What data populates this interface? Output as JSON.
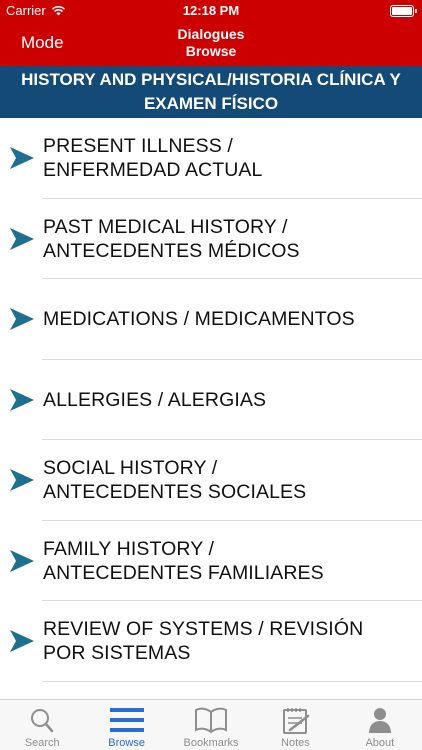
{
  "status_bar": {
    "carrier": "Carrier",
    "time": "12:18 PM"
  },
  "nav": {
    "mode_label": "Mode",
    "title_line1": "Dialogues",
    "title_line2": "Browse"
  },
  "section": {
    "title": "HISTORY AND PHYSICAL/HISTORIA CLÍNICA Y EXAMEN FÍSICO"
  },
  "list": {
    "items": [
      {
        "line1": "PRESENT ILLNESS /",
        "line2": "ENFERMEDAD ACTUAL"
      },
      {
        "line1": "PAST MEDICAL HISTORY /",
        "line2": "ANTECEDENTES MÉDICOS"
      },
      {
        "line1": "MEDICATIONS / MEDICAMENTOS",
        "line2": ""
      },
      {
        "line1": "ALLERGIES / ALERGIAS",
        "line2": ""
      },
      {
        "line1": "SOCIAL HISTORY /",
        "line2": "ANTECEDENTES SOCIALES"
      },
      {
        "line1": "FAMILY HISTORY /",
        "line2": "ANTECEDENTES FAMILIARES"
      },
      {
        "line1": "REVIEW OF SYSTEMS / REVISIÓN",
        "line2": "POR SISTEMAS"
      }
    ]
  },
  "tabs": [
    {
      "label": "Search",
      "icon": "search-icon",
      "active": false
    },
    {
      "label": "Browse",
      "icon": "list-icon",
      "active": true
    },
    {
      "label": "Bookmarks",
      "icon": "book-icon",
      "active": false
    },
    {
      "label": "Notes",
      "icon": "notes-icon",
      "active": false
    },
    {
      "label": "About",
      "icon": "person-icon",
      "active": false
    }
  ],
  "colors": {
    "header_red": "#cc0000",
    "section_blue": "#134a78",
    "chevron_teal": "#1f6f8f",
    "tab_active": "#2a6bd4",
    "tab_inactive": "#8e8e8e"
  }
}
